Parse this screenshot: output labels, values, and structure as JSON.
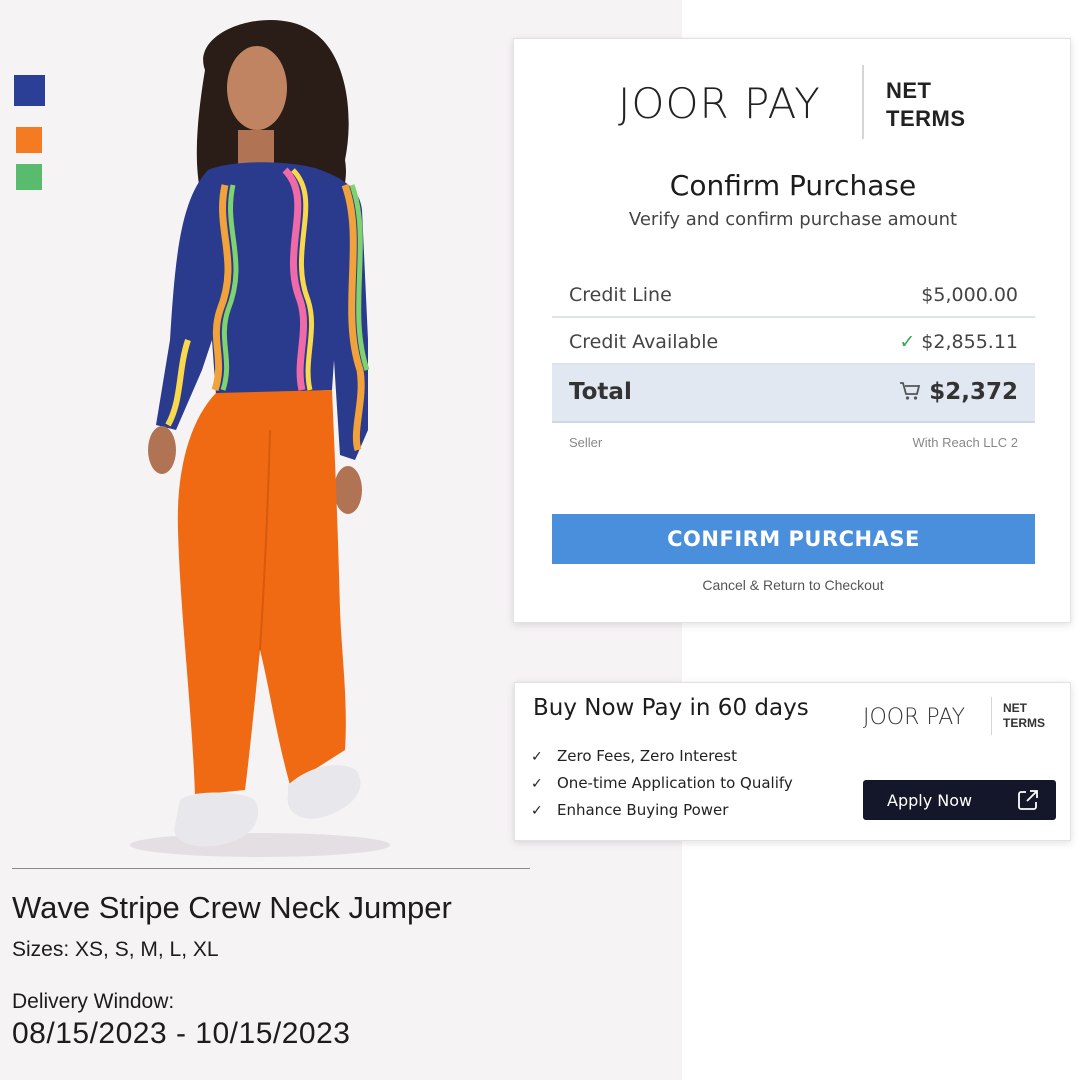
{
  "product": {
    "swatches": [
      {
        "name": "blue",
        "color": "#2b3f96"
      },
      {
        "name": "orange",
        "color": "#f57b22"
      },
      {
        "name": "green",
        "color": "#58bb6d"
      }
    ],
    "title": "Wave Stripe Crew Neck Jumper",
    "sizes": "Sizes: XS, S, M, L, XL",
    "delivery_label": "Delivery Window:",
    "delivery_dates": "08/15/2023 - 10/15/2023"
  },
  "confirm": {
    "brand_main": "JOOR PAY",
    "brand_net_line1": "NET",
    "brand_net_line2": "TERMS",
    "title": "Confirm Purchase",
    "subtitle": "Verify and confirm purchase amount",
    "credit_line_label": "Credit Line",
    "credit_line_value": "$5,000.00",
    "credit_available_label": "Credit Available",
    "credit_available_value": "$2,855.11",
    "total_label": "Total",
    "total_value": "$2,372",
    "seller_label": "Seller",
    "seller_value": "With Reach LLC 2",
    "confirm_button": "CONFIRM PURCHASE",
    "cancel_link": "Cancel & Return to Checkout",
    "accent_color": "#4a8fdb"
  },
  "bnpl": {
    "title": "Buy Now Pay in 60 days",
    "brand_main": "JOOR PAY",
    "brand_net_line1": "NET",
    "brand_net_line2": "TERMS",
    "benefits": [
      "Zero Fees, Zero Interest",
      "One-time Application to Qualify",
      "Enhance Buying Power"
    ],
    "apply_button": "Apply Now"
  },
  "icons": {
    "check": "check-icon",
    "cart": "cart-icon",
    "external": "external-link-icon"
  }
}
